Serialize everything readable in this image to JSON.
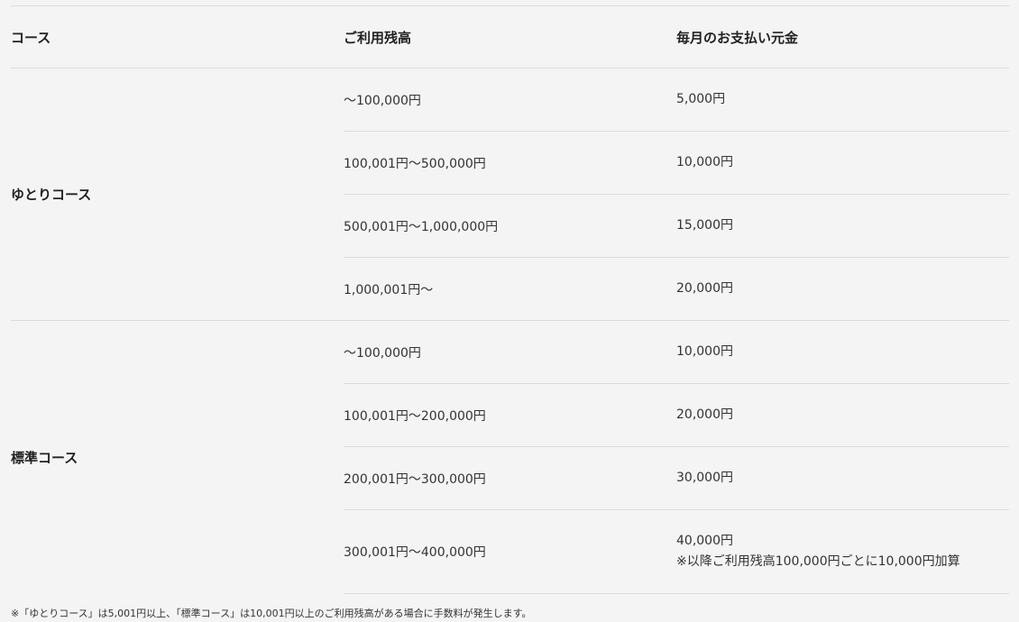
{
  "table": {
    "headers": {
      "course": "コース",
      "balance": "ご利用残高",
      "payment": "毎月のお支払い元金"
    },
    "groups": [
      {
        "course": "ゆとりコース",
        "rows": [
          {
            "balance": "～100,000円",
            "payment": "5,000円"
          },
          {
            "balance": "100,001円～500,000円",
            "payment": "10,000円"
          },
          {
            "balance": "500,001円～1,000,000円",
            "payment": "15,000円"
          },
          {
            "balance": "1,000,001円～",
            "payment": "20,000円"
          }
        ]
      },
      {
        "course": "標準コース",
        "rows": [
          {
            "balance": "～100,000円",
            "payment": "10,000円"
          },
          {
            "balance": "100,001円～200,000円",
            "payment": "20,000円"
          },
          {
            "balance": "200,001円～300,000円",
            "payment": "30,000円"
          },
          {
            "balance": "300,001円～400,000円",
            "payment": "40,000円",
            "payment_note": "※以降ご利用残高100,000円ごとに10,000円加算"
          }
        ]
      }
    ]
  },
  "footnote": "※「ゆとりコース」は5,001円以上、「標準コース」は10,001円以上のご利用残高がある場合に手数料が発生します。"
}
